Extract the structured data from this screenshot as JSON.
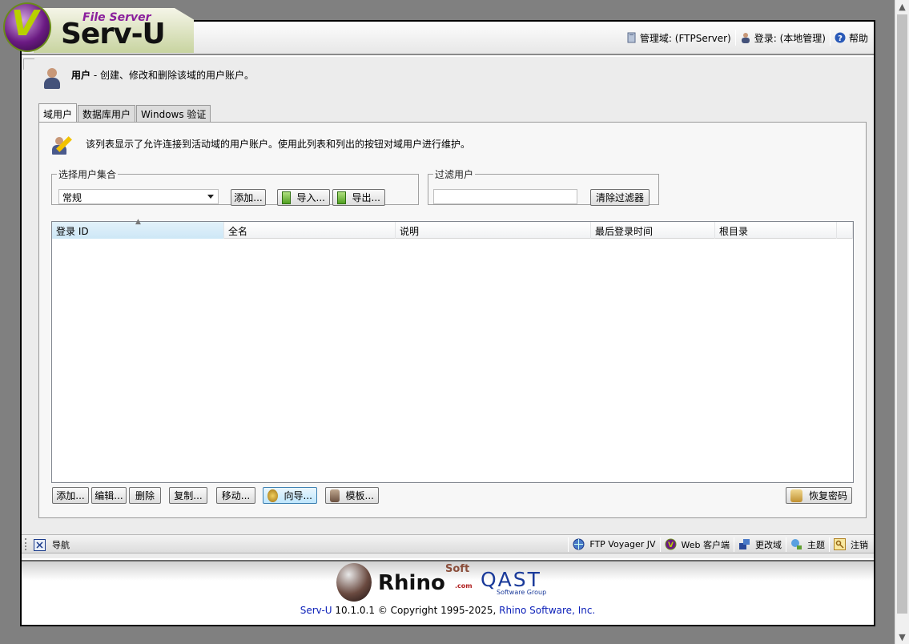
{
  "app": {
    "logo_product_line": "File Server",
    "logo_name": "Serv-U"
  },
  "header": {
    "domain_label": "管理域: (FTPServer)",
    "login_label": "登录: (本地管理)",
    "help_label": "帮助"
  },
  "page": {
    "title": "用户",
    "subtitle": " - 创建、修改和删除该域的用户账户。"
  },
  "tabs": [
    {
      "label": "域用户",
      "active": true
    },
    {
      "label": "数据库用户",
      "active": false
    },
    {
      "label": "Windows 验证",
      "active": false
    }
  ],
  "panel": {
    "description": "该列表显示了允许连接到活动域的用户账户。使用此列表和列出的按钮对域用户进行维护。",
    "user_set": {
      "legend": "选择用户集合",
      "selected": "常规",
      "add_label": "添加...",
      "import_label": "导入...",
      "export_label": "导出..."
    },
    "filter": {
      "legend": "过滤用户",
      "value": "",
      "clear_label": "清除过滤器"
    },
    "table": {
      "columns": [
        "登录 ID",
        "全名",
        "说明",
        "最后登录时间",
        "根目录"
      ],
      "sorted_column": "登录 ID",
      "rows": []
    },
    "actions": {
      "add": "添加...",
      "edit": "编辑...",
      "delete": "删除",
      "copy": "复制...",
      "move": "移动...",
      "wizard": "向导...",
      "template": "模板...",
      "recover_password": "恢复密码"
    }
  },
  "navbar": {
    "nav_label": "导航",
    "items": [
      "FTP Voyager JV",
      "Web 客户端",
      "更改域",
      "主题",
      "注销"
    ]
  },
  "footer": {
    "rhino_soft": "Soft",
    "rhino": "Rhino",
    "rhino_com": ".com",
    "qast": "QAST",
    "qast_sub": "Software Group",
    "product": "Serv-U",
    "version_text": " 10.1.0.1 © Copyright 1995-2025, ",
    "company": "Rhino Software, Inc."
  },
  "colors": {
    "link": "#0b1fb8",
    "logo_purple": "#6b1a83",
    "logo_green": "#b8d000"
  }
}
